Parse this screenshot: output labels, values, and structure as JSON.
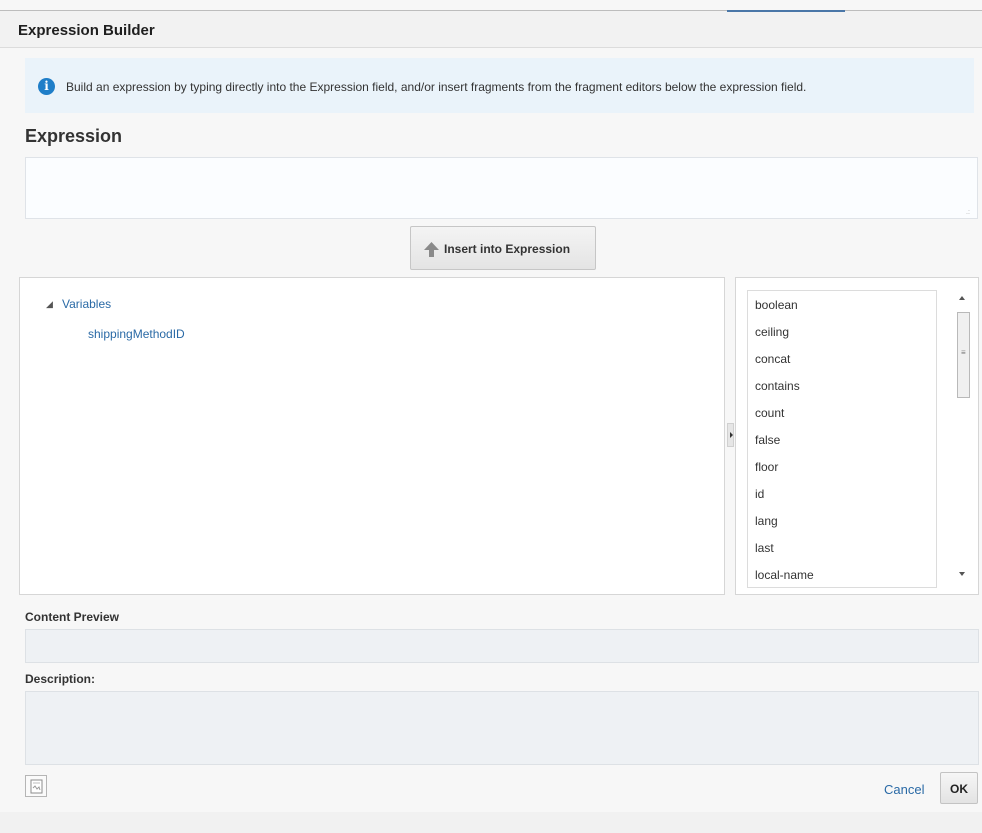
{
  "dialog": {
    "title": "Expression Builder",
    "info_text": "Build an expression by typing directly into the Expression field, and/or insert fragments from the fragment editors below the expression field.",
    "info_icon": "info-icon",
    "expression_title": "Expression",
    "expression_value": "",
    "insert_button_label": "Insert into Expression"
  },
  "tree": {
    "root_label": "Variables",
    "children": [
      "shippingMethodID"
    ]
  },
  "functions": {
    "items": [
      "boolean",
      "ceiling",
      "concat",
      "contains",
      "count",
      "false",
      "floor",
      "id",
      "lang",
      "last",
      "local-name"
    ]
  },
  "bottom": {
    "content_preview_label": "Content Preview",
    "description_label": "Description:",
    "cancel_label": "Cancel",
    "ok_label": "OK"
  },
  "colors": {
    "accent": "#2a6aa6",
    "info_bg": "#eaf3fa",
    "info_icon": "#1f7ec8"
  }
}
